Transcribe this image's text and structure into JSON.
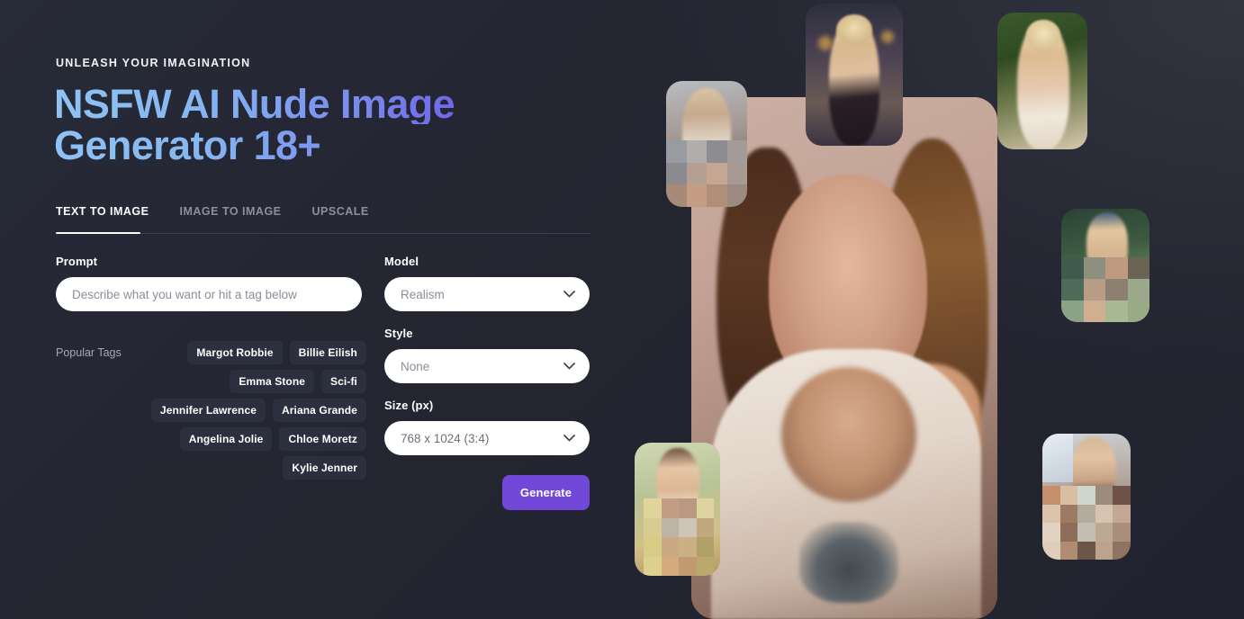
{
  "page": {
    "background_color": "#212330",
    "accent_color": "#7248d9"
  },
  "hero": {
    "eyebrow": "UNLEASH YOUR IMAGINATION",
    "title_line1": "NSFW AI Nude Image",
    "title_line2": "Generator 18+",
    "gradient_start": "#8fc2f5",
    "gradient_end": "#6a52e4"
  },
  "tabs": {
    "items": [
      {
        "label": "TEXT TO IMAGE",
        "active": true
      },
      {
        "label": "IMAGE TO IMAGE",
        "active": false
      },
      {
        "label": "UPSCALE",
        "active": false
      }
    ]
  },
  "form": {
    "prompt": {
      "label": "Prompt",
      "value": "",
      "placeholder": "Describe what you want or hit a tag below"
    },
    "model": {
      "label": "Model",
      "value": "Realism",
      "icon": "chevron-down-icon"
    },
    "style": {
      "label": "Style",
      "value": "None",
      "icon": "chevron-down-icon"
    },
    "size": {
      "label": "Size (px)",
      "value": "768 x 1024 (3:4)",
      "icon": "chevron-down-icon"
    },
    "generate_label": "Generate"
  },
  "tags": {
    "label": "Popular Tags",
    "items": [
      "Margot Robbie",
      "Billie Eilish",
      "Emma Stone",
      "Sci-fi",
      "Jennifer Lawrence",
      "Ariana Grande",
      "Angelina Jolie",
      "Chloe Moretz",
      "Kylie Jenner"
    ]
  },
  "collage": {
    "description": "Overlapping rounded AI-generated portrait thumbnails around a large central portrait",
    "thumb_count": 6
  }
}
